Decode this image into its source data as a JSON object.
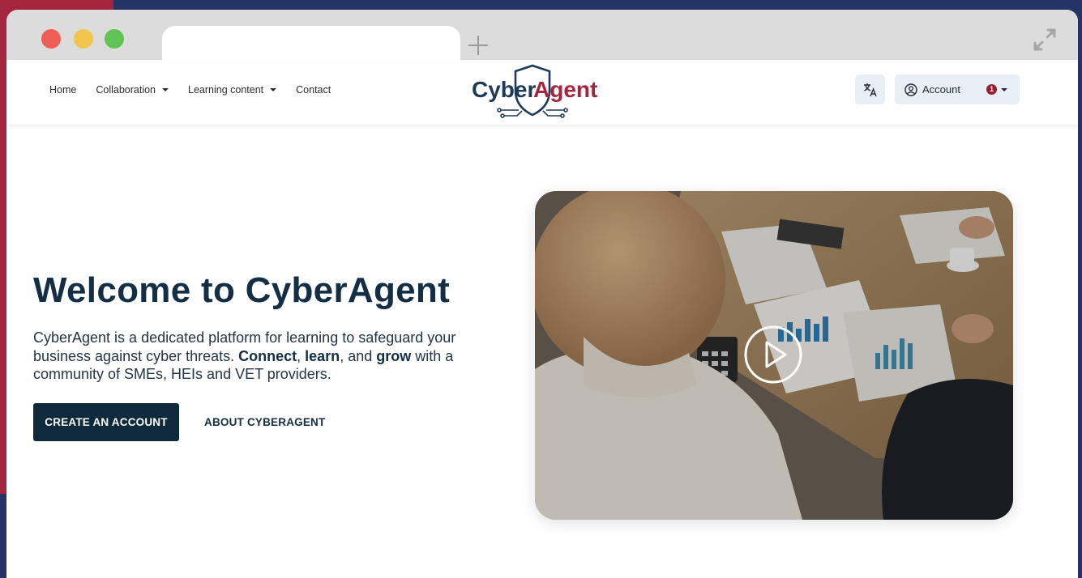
{
  "nav": {
    "links": [
      {
        "label": "Home",
        "dropdown": false
      },
      {
        "label": "Collaboration",
        "dropdown": true
      },
      {
        "label": "Learning content",
        "dropdown": true
      },
      {
        "label": "Contact",
        "dropdown": false
      }
    ],
    "logo": {
      "part1": "Cyber",
      "part2": "Agent"
    },
    "language_icon": "translate-icon",
    "account_label": "Account",
    "notification_count": "1"
  },
  "hero": {
    "title": "Welcome to CyberAgent",
    "description_parts": [
      "CyberAgent is a dedicated platform for learning to safeguard your business against cyber threats. ",
      "Connect",
      ", ",
      "learn",
      ", and ",
      "grow",
      " with a community of SMEs, HEIs and VET providers."
    ],
    "primary_button": "CREATE AN ACCOUNT",
    "secondary_button": "ABOUT CYBERAGENT"
  },
  "video": {
    "play_icon": "play-icon"
  },
  "colors": {
    "brand_navy": "#132e45",
    "brand_red": "#a4263e",
    "button_dark": "#0f2a3a",
    "background_blue": "#253466"
  }
}
